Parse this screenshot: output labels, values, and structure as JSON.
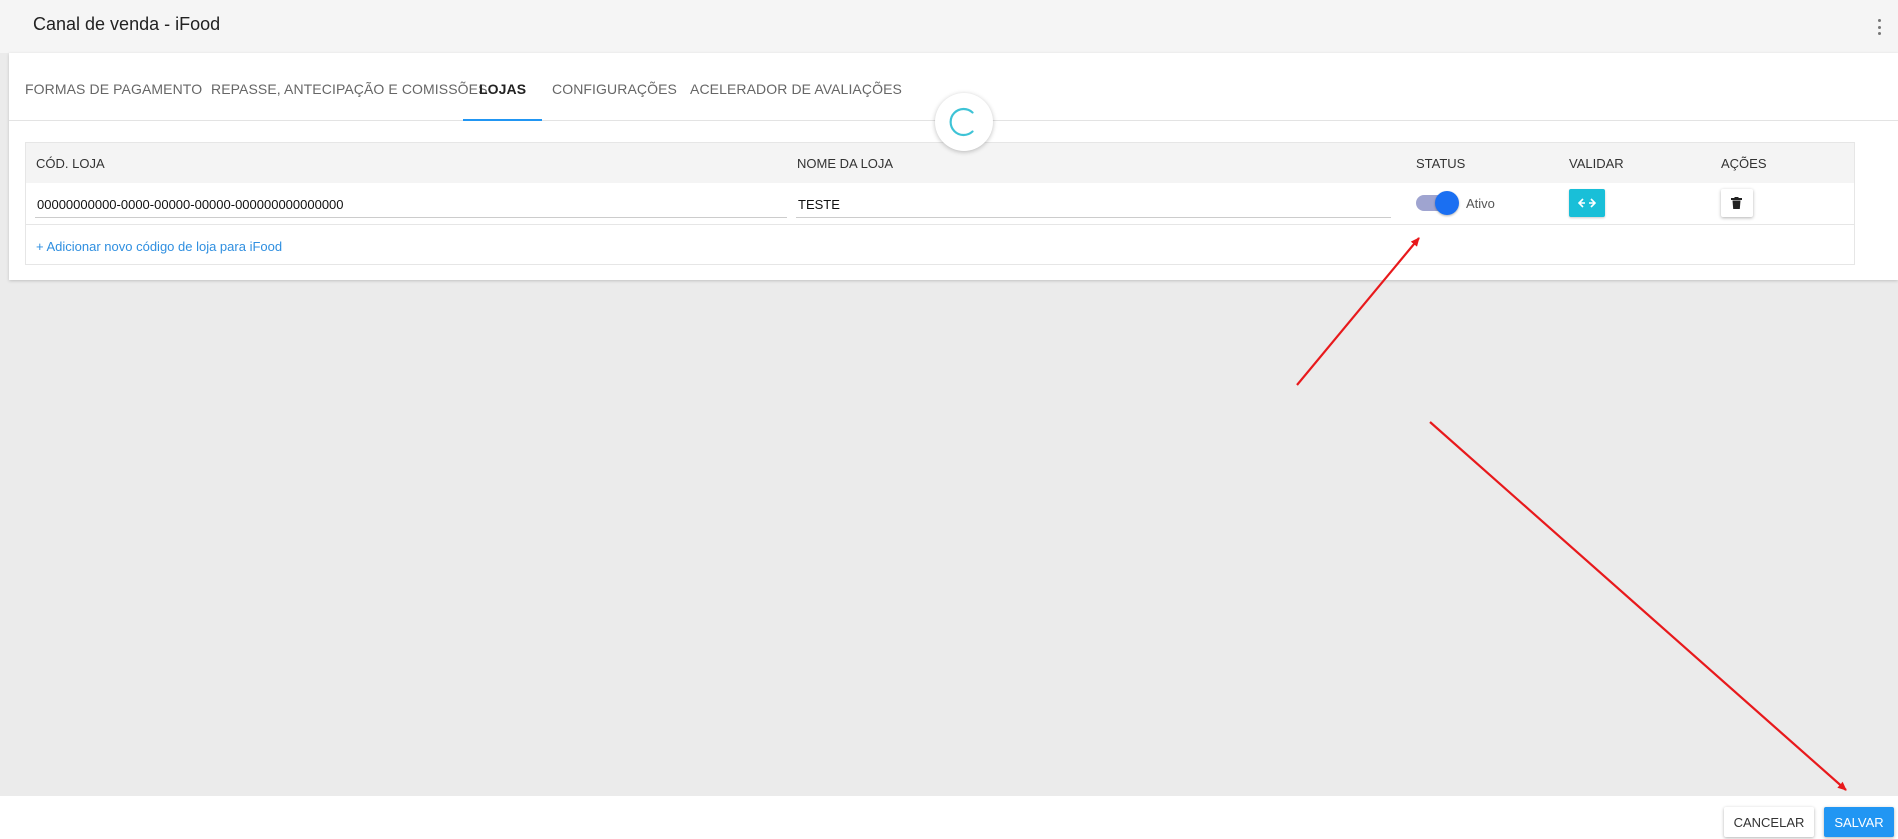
{
  "header": {
    "title": "Canal de venda - iFood",
    "menu_icon": "more-vert-icon"
  },
  "tabs": [
    {
      "label": "FORMAS DE PAGAMENTO",
      "active": false
    },
    {
      "label": "REPASSE, ANTECIPAÇÃO E COMISSÕES",
      "active": false
    },
    {
      "label": "LOJAS",
      "active": true
    },
    {
      "label": "CONFIGURAÇÕES",
      "active": false
    },
    {
      "label": "ACELERADOR DE AVALIAÇÕES",
      "active": false
    }
  ],
  "table": {
    "columns": [
      "CÓD. LOJA",
      "NOME DA LOJA",
      "STATUS",
      "VALIDAR",
      "AÇÕES"
    ],
    "rows": [
      {
        "store_code": "00000000000-0000-00000-00000-000000000000000",
        "store_name": "TESTE",
        "status_on": true,
        "status_label": "Ativo",
        "validate_icon": "swap-horiz-icon",
        "delete_icon": "trash-icon"
      }
    ],
    "add_link": "+ Adicionar novo código de loja para iFood"
  },
  "footer": {
    "cancel_label": "CANCELAR",
    "save_label": "SALVAR"
  },
  "colors": {
    "accent": "#2196f3",
    "toggle_knob": "#1a6ff2",
    "validate_button": "#19bfd8",
    "annotation_arrow": "#e8191c",
    "spinner": "#3ec3d6"
  },
  "loading_spinner": "spinner-icon"
}
